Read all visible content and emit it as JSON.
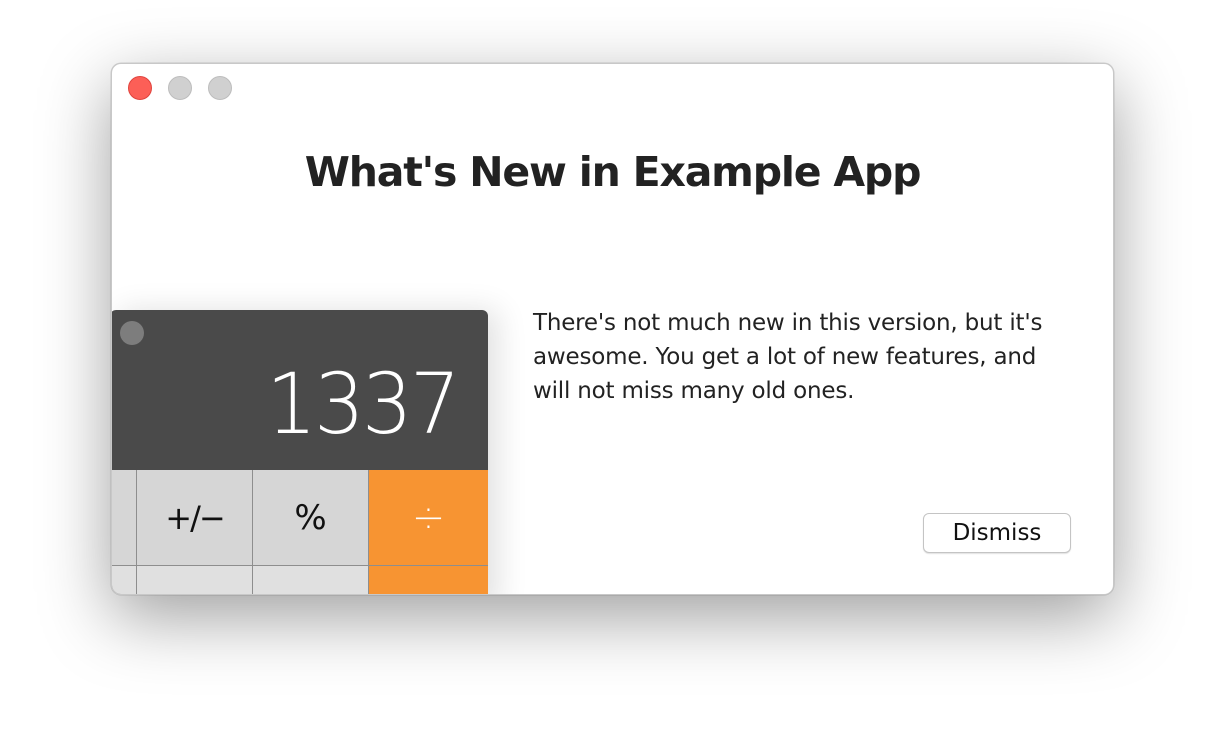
{
  "window": {
    "title": "What's New in Example App",
    "controls": [
      "close",
      "minimize",
      "zoom"
    ]
  },
  "illustration": {
    "display_value": "1337",
    "keys": {
      "row1": [
        "",
        "+/−",
        "%",
        "÷"
      ],
      "row2": [
        "",
        "",
        "",
        ""
      ]
    },
    "colors": {
      "display_bg": "#4a4a4a",
      "key_bg": "#d6d6d6",
      "operator_bg": "#f79432"
    }
  },
  "content": {
    "description": "There's not much new in this version, but it's awesome. You get a lot of new features, and will not miss many old ones."
  },
  "actions": {
    "dismiss_label": "Dismiss"
  },
  "colors": {
    "close_button": "#fc5f57",
    "inactive_button": "#d0d0d0"
  }
}
